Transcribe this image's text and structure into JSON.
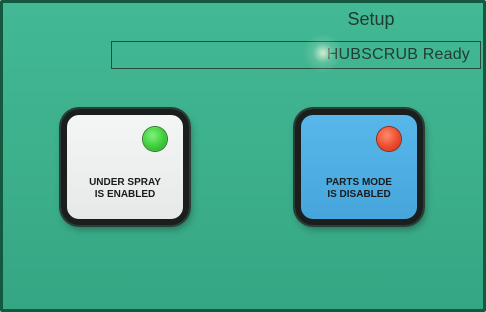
{
  "header": {
    "title": "Setup",
    "status": "HUBSCRUB Ready"
  },
  "buttons": [
    {
      "line1": "UNDER SPRAY",
      "line2": "IS ENABLED",
      "indicator": "green",
      "indicator_color": "#3dcc3a",
      "face_color": "#eef0ef"
    },
    {
      "line1": "PARTS MODE",
      "line2": "IS DISABLED",
      "indicator": "red",
      "indicator_color": "#ec4b2c",
      "face_color": "#52b1e6"
    }
  ],
  "colors": {
    "screen_background": "#3db08c",
    "frame": "#14583f"
  }
}
